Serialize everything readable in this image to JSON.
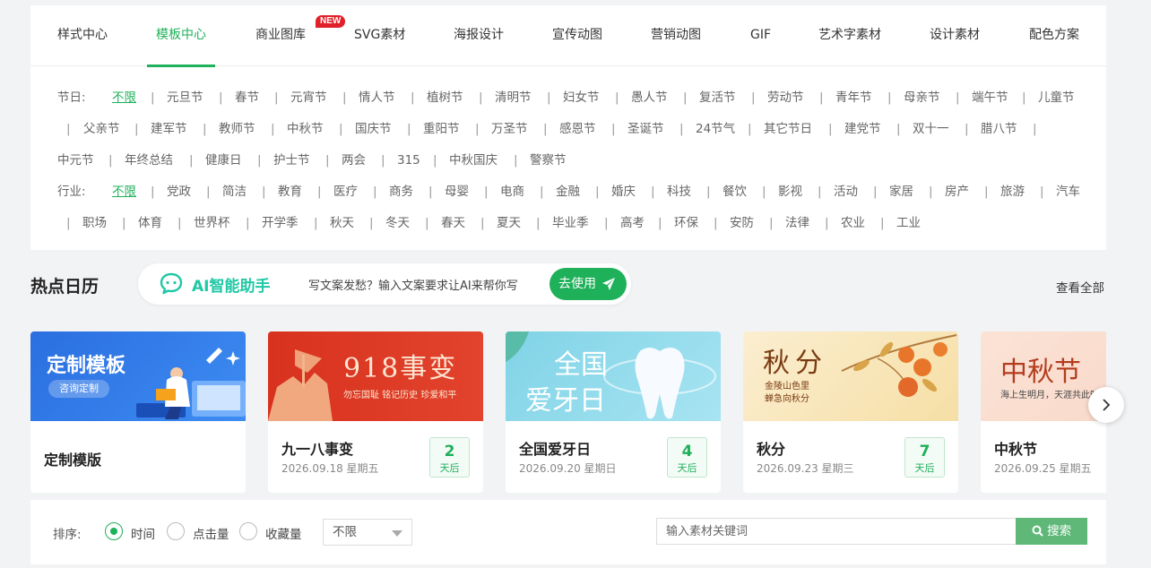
{
  "tabs": [
    {
      "label": "样式中心"
    },
    {
      "label": "模板中心"
    },
    {
      "label": "商业图库"
    },
    {
      "label": "SVG素材"
    },
    {
      "label": "海报设计"
    },
    {
      "label": "宣传动图"
    },
    {
      "label": "营销动图"
    },
    {
      "label": "GIF"
    },
    {
      "label": "艺术字素材"
    },
    {
      "label": "设计素材"
    },
    {
      "label": "配色方案"
    }
  ],
  "new_badge": "NEW",
  "festival_filter": {
    "label": "节日:",
    "items": [
      "不限",
      "元旦节",
      "春节",
      "元宵节",
      "情人节",
      "植树节",
      "清明节",
      "妇女节",
      "愚人节",
      "复活节",
      "劳动节",
      "青年节",
      "母亲节",
      "端午节",
      "儿童节",
      "父亲节",
      "建军节",
      "教师节",
      "中秋节",
      "国庆节",
      "重阳节",
      "万圣节",
      "感恩节",
      "圣诞节",
      "24节气",
      "其它节日",
      "建党节",
      "双十一",
      "腊八节",
      "中元节",
      "年终总结",
      "健康日",
      "护士节",
      "两会",
      "315",
      "中秋国庆",
      "警察节"
    ]
  },
  "industry_filter": {
    "label": "行业:",
    "items": [
      "不限",
      "党政",
      "简洁",
      "教育",
      "医疗",
      "商务",
      "母婴",
      "电商",
      "金融",
      "婚庆",
      "科技",
      "餐饮",
      "影视",
      "活动",
      "家居",
      "房产",
      "旅游",
      "汽车",
      "职场",
      "体育",
      "世界杯",
      "开学季",
      "秋天",
      "冬天",
      "春天",
      "夏天",
      "毕业季",
      "高考",
      "环保",
      "安防",
      "法律",
      "农业",
      "工业"
    ]
  },
  "hot_calendar": {
    "title": "热点日历",
    "view_all": "查看全部"
  },
  "ai_assistant": {
    "name": "AI智能助手",
    "description": "写文案发愁？输入文案要求让AI来帮你写",
    "button": "去使用"
  },
  "custom_card": {
    "banner_title": "定制模板",
    "banner_button": "咨询定制",
    "title": "定制模版"
  },
  "event_cards": [
    {
      "title": "九一八事变",
      "date": "2026.09.18 星期五",
      "days": "2",
      "unit": "天后",
      "thumb_title": "918事变",
      "thumb_sub": "勿忘国耻 铭记历史 珍爱和平"
    },
    {
      "title": "全国爱牙日",
      "date": "2026.09.20 星期日",
      "days": "4",
      "unit": "天后",
      "thumb_title_1": "全国",
      "thumb_title_2": "爱牙日"
    },
    {
      "title": "秋分",
      "date": "2026.09.23 星期三",
      "days": "7",
      "unit": "天后",
      "thumb_title": "秋分",
      "thumb_sub_1": "金陵山色里",
      "thumb_sub_2": "蝉急向秋分"
    },
    {
      "title": "中秋节",
      "date": "2026.09.25 星期五",
      "thumb_title": "中秋节",
      "thumb_sub": "海上生明月，天涯共此时"
    }
  ],
  "sort": {
    "label": "排序:",
    "options": [
      "时间",
      "点击量",
      "收藏量"
    ],
    "selected": "时间",
    "select_value": "不限"
  },
  "search": {
    "placeholder": "输入素材关键词",
    "button": "搜索"
  },
  "colors": {
    "accent": "#1fb05a",
    "ai": "#1fc8a5",
    "badge": "#e0212a"
  }
}
